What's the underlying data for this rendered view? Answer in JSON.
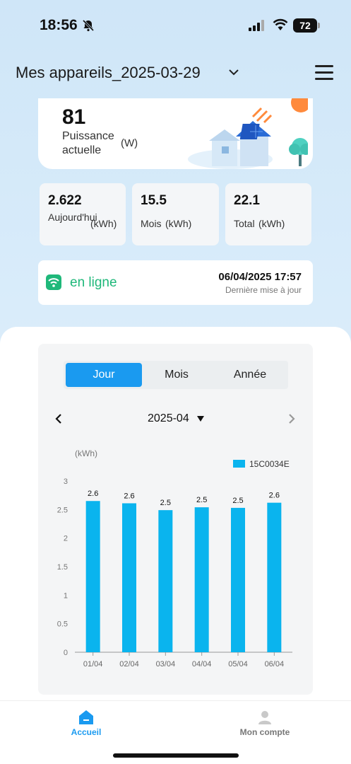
{
  "status_bar": {
    "time": "18:56",
    "battery": "72"
  },
  "header": {
    "title": "Mes appareils_2025-03-29"
  },
  "power": {
    "value": "81",
    "label": "Puissance actuelle",
    "unit": "(W)"
  },
  "stats": [
    {
      "value": "2.622",
      "label": "Aujourd'hui",
      "unit": "(kWh)"
    },
    {
      "value": "15.5",
      "label": "Mois",
      "unit": "(kWh)"
    },
    {
      "value": "22.1",
      "label": "Total",
      "unit": "(kWh)"
    }
  ],
  "connection": {
    "status": "en ligne",
    "update_time": "06/04/2025 17:57",
    "update_label": "Dernière mise à jour"
  },
  "tabs": [
    "Jour",
    "Mois",
    "Année"
  ],
  "active_tab": "Jour",
  "date_selector": {
    "value": "2025-04"
  },
  "colors": {
    "accent": "#1a9af0",
    "bar": "#0ab4ee",
    "online": "#1fb87a"
  },
  "chart_data": {
    "type": "bar",
    "ylabel": "(kWh)",
    "categories": [
      "01/04",
      "02/04",
      "03/04",
      "04/04",
      "05/04",
      "06/04"
    ],
    "series": [
      {
        "name": "15C0034E",
        "values": [
          2.65,
          2.61,
          2.49,
          2.54,
          2.53,
          2.62
        ]
      }
    ],
    "data_labels": [
      "2.6",
      "2.6",
      "2.5",
      "2.5",
      "2.5",
      "2.6"
    ],
    "yticks": [
      "0",
      "0.5",
      "1",
      "1.5",
      "2",
      "2.5",
      "3"
    ],
    "ylim": [
      0,
      3
    ],
    "legend": "top-right",
    "grid": false
  },
  "nav": [
    {
      "label": "Accueil",
      "icon": "home-icon"
    },
    {
      "label": "Mon compte",
      "icon": "user-icon"
    }
  ]
}
